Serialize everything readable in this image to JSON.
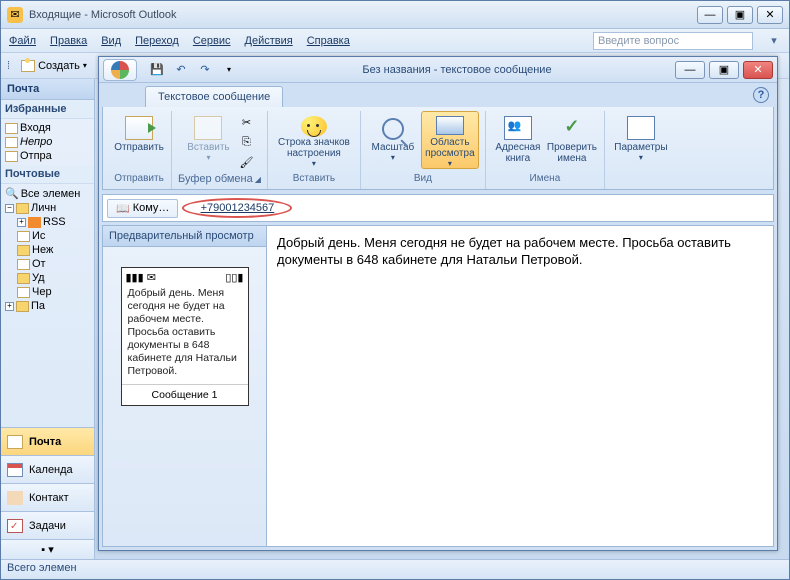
{
  "outer": {
    "title": "Входящие - Microsoft Outlook",
    "ask_placeholder": "Введите вопрос"
  },
  "menu": {
    "file": "Файл",
    "edit": "Правка",
    "view": "Вид",
    "go": "Переход",
    "tools": "Сервис",
    "actions": "Действия",
    "help": "Справка"
  },
  "toolbar": {
    "create": "Создать"
  },
  "left": {
    "mail_title": "Почта",
    "fav_folders": "Избранные",
    "inbox": "Входя",
    "unread": "Непро",
    "sent": "Отпра",
    "mail_folders": "Почтовые",
    "all_items": "Все элемен",
    "personal": "Личн",
    "rss": "RSS",
    "outgoing": "Ис",
    "junk": "Неж",
    "sent2": "От",
    "deleted": "Уд",
    "drafts": "Чер",
    "search": "Па"
  },
  "nav": {
    "mail": "Почта",
    "calendar": "Календа",
    "contacts": "Контакт",
    "tasks": "Задачи"
  },
  "status": "Всего элемен",
  "msg": {
    "title": "Без названия - текстовое сообщение",
    "tab": "Текстовое сообщение",
    "to_label": "Кому…",
    "to_value": "+79001234567",
    "preview_title": "Предварительный просмотр",
    "preview_text": "Добрый день. Меня сегодня не будет на рабочем месте. Просьба оставить документы в 648 кабинете для Натальи Петровой.",
    "msg_footer": "Сообщение 1",
    "body": "Добрый день. Меня сегодня не будет на рабочем месте. Просьба оставить документы в 648 кабинете для Натальи Петровой."
  },
  "ribbon": {
    "send": {
      "label": "Отправить",
      "group": "Отправить"
    },
    "clipboard": {
      "paste": "Вставить",
      "group": "Буфер обмена"
    },
    "insert": {
      "emoticons": "Строка значков настроения",
      "group": "Вставить"
    },
    "zoom": {
      "label": "Масштаб",
      "group": "Вид"
    },
    "viewarea": {
      "label": "Область просмотра"
    },
    "names": {
      "book": "Адресная книга",
      "check": "Проверить имена",
      "group": "Имена"
    },
    "options": {
      "label": "Параметры"
    }
  }
}
